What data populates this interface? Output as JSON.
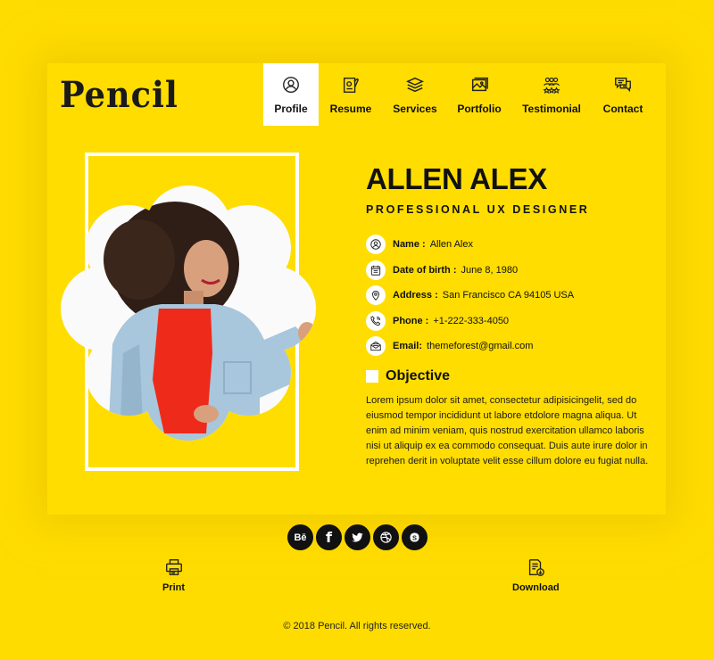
{
  "brand": {
    "logo": "Pencil"
  },
  "nav": {
    "items": [
      {
        "label": "Profile",
        "icon": "profile-icon",
        "active": true
      },
      {
        "label": "Resume",
        "icon": "resume-icon",
        "active": false
      },
      {
        "label": "Services",
        "icon": "layers-icon",
        "active": false
      },
      {
        "label": "Portfolio",
        "icon": "image-icon",
        "active": false
      },
      {
        "label": "Testimonial",
        "icon": "people-icon",
        "active": false
      },
      {
        "label": "Contact",
        "icon": "chat-icon",
        "active": false
      }
    ]
  },
  "profile": {
    "name": "ALLEN ALEX",
    "title": "PROFESSIONAL UX DESIGNER",
    "photo_alt": "Smiling woman with curly hair in denim shirt and red top",
    "details": [
      {
        "icon": "user-icon",
        "label": "Name :",
        "value": "Allen Alex"
      },
      {
        "icon": "calendar-icon",
        "label": "Date of birth :",
        "value": "June 8, 1980"
      },
      {
        "icon": "location-icon",
        "label": "Address :",
        "value": "San Francisco CA 94105 USA"
      },
      {
        "icon": "phone-icon",
        "label": "Phone :",
        "value": "+1-222-333-4050"
      },
      {
        "icon": "mail-icon",
        "label": "Email:",
        "value": "themeforest@gmail.com"
      }
    ],
    "objective_heading": "Objective",
    "objective_text": "Lorem ipsum dolor sit amet, consectetur adipisicingelit, sed do eiusmod tempor incididunt ut labore etdolore magna aliqua. Ut enim ad minim veniam, quis nostrud exercitation ullamco laboris nisi ut aliquip ex ea commodo consequat. Duis aute irure dolor in reprehen derit in voluptate velit esse cillum dolore eu fugiat nulla."
  },
  "social": [
    {
      "name": "behance",
      "glyph": "Bē"
    },
    {
      "name": "facebook",
      "glyph": "f"
    },
    {
      "name": "twitter",
      "glyph": ""
    },
    {
      "name": "dribbble",
      "glyph": ""
    },
    {
      "name": "skype",
      "glyph": "S"
    }
  ],
  "actions": {
    "print": "Print",
    "download": "Download"
  },
  "footer": {
    "copyright": "© 2018 Pencil. All rights reserved."
  },
  "colors": {
    "background": "#ffdc00",
    "card": "#ffdd00",
    "text": "#111111",
    "active_tab": "#ffffff"
  }
}
